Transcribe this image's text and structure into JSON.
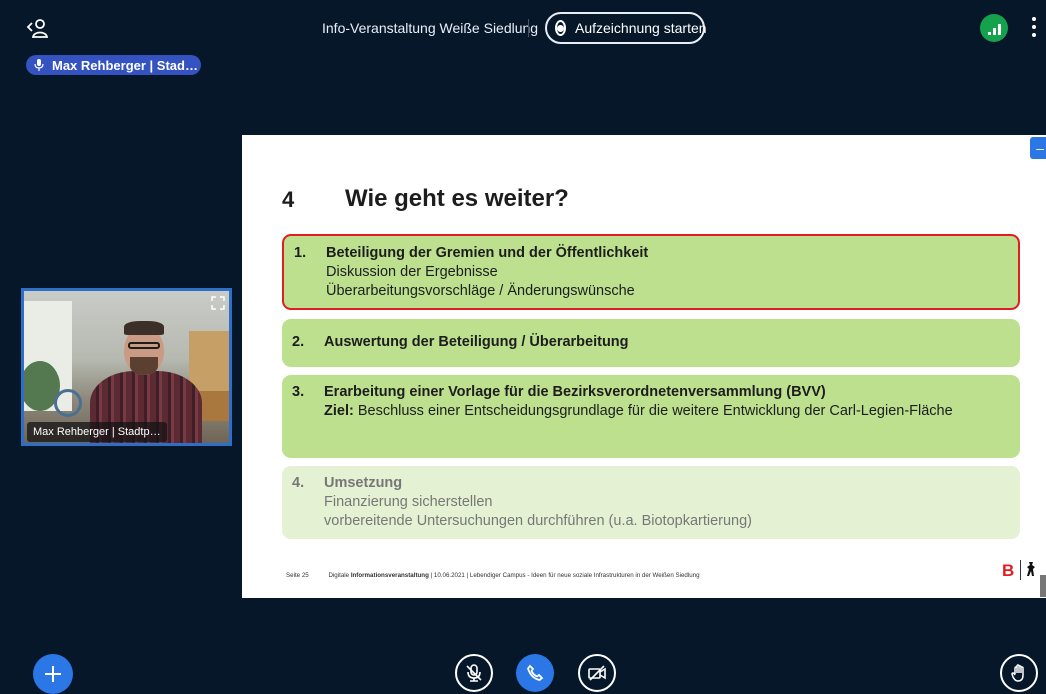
{
  "meeting": {
    "title": "Info-Veranstaltung Weiße Siedlung",
    "record_label": "Aufzeichnung starten"
  },
  "talker": {
    "name": "Max Rehberger | Stad…"
  },
  "webcam": {
    "label": "Max Rehberger | Stadtp…"
  },
  "slide": {
    "number": "4",
    "heading": "Wie geht es weiter?",
    "items": [
      {
        "num": "1.",
        "title": "Beteiligung der Gremien und der Öffentlichkeit",
        "line1": "Diskussion der Ergebnisse",
        "line2": "Überarbeitungsvorschläge / Änderungswünsche"
      },
      {
        "num": "2.",
        "title": "Auswertung der Beteiligung / Überarbeitung"
      },
      {
        "num": "3.",
        "title": "Erarbeitung einer Vorlage für die Bezirksverordnetenversammlung (BVV)",
        "goal_label": "Ziel:",
        "goal_text": "Beschluss einer Entscheidungsgrundlage für die weitere Entwicklung der Carl-Legien-Fläche"
      },
      {
        "num": "4.",
        "title": "Umsetzung",
        "line1": "Finanzierung sicherstellen",
        "line2": "vorbereitende Untersuchungen durchführen (u.a. Biotopkartierung)"
      }
    ],
    "footer": {
      "page": "Seite 25",
      "prefix": "Digitale ",
      "bold": "Informationsveranstaltung",
      "rest": " | 10.06.2021 | Lebendiger Campus - Ideen für neue soziale Infrastrukturen in der Weißen Siedlung"
    },
    "logo": "B"
  },
  "colors": {
    "background": "#06172a",
    "accent_blue": "#2b77e5",
    "connection_green": "#14a34c",
    "highlight_red": "#e21c24",
    "box_green": "#bde08f",
    "box_green_light": "#e4f2d3"
  },
  "icons": [
    "users-icon",
    "record-icon",
    "connection-status-icon",
    "more-options-icon",
    "microphone-icon",
    "expand-icon",
    "plus-icon",
    "muted-microphone-icon",
    "phone-icon",
    "video-off-icon",
    "raise-hand-icon"
  ]
}
